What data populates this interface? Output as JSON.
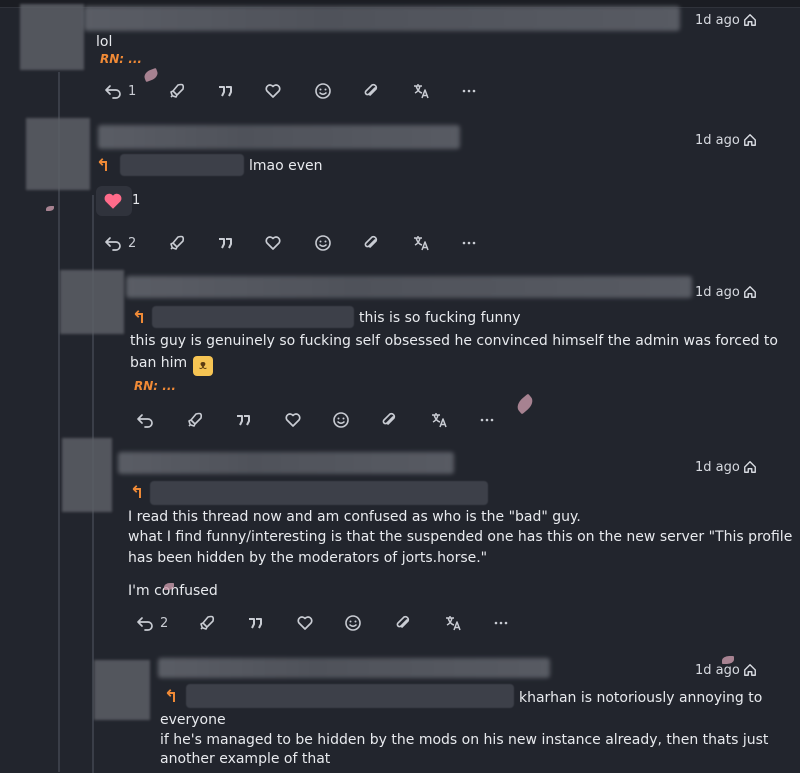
{
  "notes": [
    {
      "time": "1d ago",
      "text": "lol",
      "rn": "RN: ...",
      "reply_count": "1"
    },
    {
      "time": "1d ago",
      "text": "lmao even",
      "reaction": {
        "emoji": "heart",
        "count": "1"
      },
      "reply_count": "2"
    },
    {
      "time": "1d ago",
      "text_lines": [
        "this is so fucking funny",
        "this guy is genuinely so fucking self obsessed he convinced himself the admin was forced to",
        "ban him"
      ],
      "rn": "RN: ...",
      "reply_count": ""
    },
    {
      "time": "1d ago",
      "text_lines": [
        "I read this thread now and am confused as who is the \"bad\" guy.",
        "what I find funny/interesting is that the suspended one has this on the new server \"This profile",
        "has been hidden by the moderators of jorts.horse.\"",
        "",
        "I'm confused"
      ],
      "reply_count": "2"
    },
    {
      "time": "1d ago",
      "text_lines": [
        "kharhan is notoriously annoying to",
        "everyone",
        "if he's managed to be hidden by the mods on his new instance already, then thats just",
        "another example of that"
      ]
    }
  ],
  "colors": {
    "background": "#22252d",
    "accent": "#f08a36",
    "heart": "#ff6b8a",
    "text": "#e8eaee",
    "muted": "#c9ccd3"
  },
  "icons": {
    "visibility": "home-icon",
    "reply": "reply-icon",
    "renote": "rocket-icon",
    "quote": "quote-icon",
    "react": "heart-outline-icon",
    "emoji": "smile-icon",
    "clip": "paperclip-icon",
    "translate": "translate-icon",
    "more": "more-icon"
  }
}
